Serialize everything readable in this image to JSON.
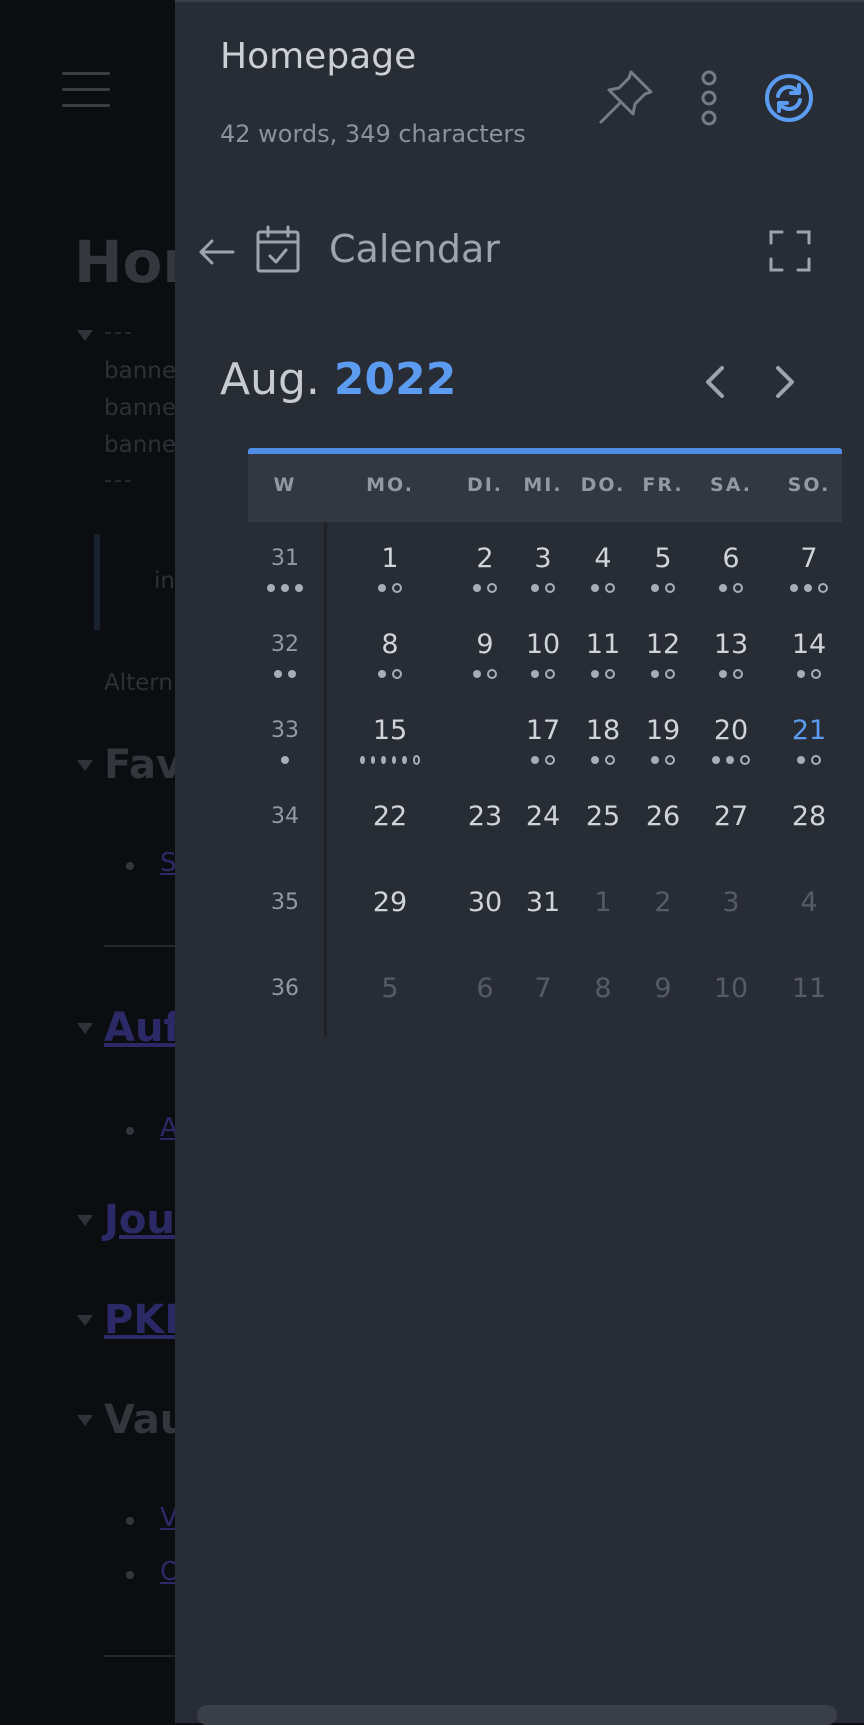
{
  "background_note": {
    "title_fragment": "Hor",
    "frontmatter_dashes": "---",
    "property_fragment": "banne",
    "callout_fragment": "in",
    "alt_fragment": "Altern",
    "headings": [
      "Fav",
      "Auf",
      "Jou",
      "PKM",
      "Vau"
    ],
    "links": [
      "S",
      "A",
      "V",
      "O"
    ]
  },
  "panel": {
    "note_title": "Homepage",
    "note_stats": "42 words, 349 characters",
    "header_icons": [
      "pin-icon",
      "more-vertical-icon",
      "sync-icon"
    ],
    "view_title": "Calendar",
    "view_icons": [
      "back-arrow-icon",
      "calendar-check-icon",
      "expand-icon"
    ]
  },
  "calendar": {
    "month": "Aug.",
    "year": "2022",
    "headers": [
      "W",
      "MO.",
      "DI.",
      "MI.",
      "DO.",
      "FR.",
      "SA.",
      "SO."
    ],
    "weeks": [
      {
        "w": "31",
        "wdots": "fff",
        "days": [
          {
            "n": "1",
            "dots": "fh"
          },
          {
            "n": "2",
            "dots": "fh"
          },
          {
            "n": "3",
            "dots": "fh"
          },
          {
            "n": "4",
            "dots": "fh"
          },
          {
            "n": "5",
            "dots": "fh"
          },
          {
            "n": "6",
            "dots": "fh"
          },
          {
            "n": "7",
            "dots": "ffh"
          }
        ]
      },
      {
        "w": "32",
        "wdots": "ff",
        "days": [
          {
            "n": "8",
            "dots": "fh"
          },
          {
            "n": "9",
            "dots": "fh"
          },
          {
            "n": "10",
            "dots": "fh"
          },
          {
            "n": "11",
            "dots": "fh"
          },
          {
            "n": "12",
            "dots": "fh"
          },
          {
            "n": "13",
            "dots": "fh"
          },
          {
            "n": "14",
            "dots": "fh"
          }
        ]
      },
      {
        "w": "33",
        "wdots": "f",
        "days": [
          {
            "n": "15",
            "dots": "fffffh"
          },
          {
            "n": "",
            "dots": ""
          },
          {
            "n": "17",
            "dots": "fh"
          },
          {
            "n": "18",
            "dots": "fh"
          },
          {
            "n": "19",
            "dots": "fh"
          },
          {
            "n": "20",
            "dots": "ffh"
          },
          {
            "n": "21",
            "dots": "fh",
            "today": true
          }
        ]
      },
      {
        "w": "34",
        "wdots": "",
        "days": [
          {
            "n": "22",
            "dots": ""
          },
          {
            "n": "23",
            "dots": ""
          },
          {
            "n": "24",
            "dots": ""
          },
          {
            "n": "25",
            "dots": ""
          },
          {
            "n": "26",
            "dots": ""
          },
          {
            "n": "27",
            "dots": ""
          },
          {
            "n": "28",
            "dots": ""
          }
        ]
      },
      {
        "w": "35",
        "wdots": "",
        "days": [
          {
            "n": "29",
            "dots": ""
          },
          {
            "n": "30",
            "dots": ""
          },
          {
            "n": "31",
            "dots": ""
          },
          {
            "n": "1",
            "dots": "",
            "other": true
          },
          {
            "n": "2",
            "dots": "",
            "other": true
          },
          {
            "n": "3",
            "dots": "",
            "other": true
          },
          {
            "n": "4",
            "dots": "",
            "other": true
          }
        ]
      },
      {
        "w": "36",
        "wdots": "",
        "days": [
          {
            "n": "5",
            "dots": "",
            "other": true
          },
          {
            "n": "6",
            "dots": "",
            "other": true
          },
          {
            "n": "7",
            "dots": "",
            "other": true
          },
          {
            "n": "8",
            "dots": "",
            "other": true
          },
          {
            "n": "9",
            "dots": "",
            "other": true
          },
          {
            "n": "10",
            "dots": "",
            "other": true
          },
          {
            "n": "11",
            "dots": "",
            "other": true
          }
        ]
      }
    ],
    "colors": {
      "accent": "#5b9bf0",
      "panel_bg": "#282c35",
      "header_bg": "#323741"
    }
  }
}
